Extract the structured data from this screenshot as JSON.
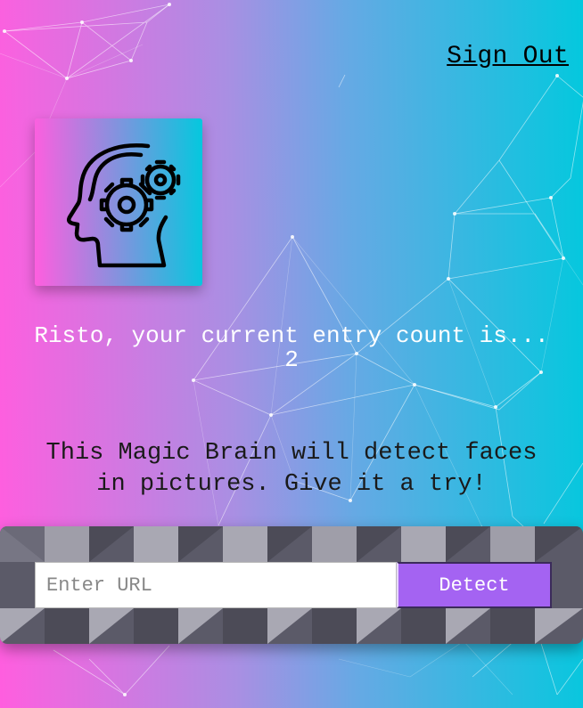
{
  "nav": {
    "sign_out_label": "Sign Out"
  },
  "logo": {
    "icon": "brain-gears-icon"
  },
  "rank": {
    "message": "Risto, your current entry count is...",
    "count": "2"
  },
  "description": {
    "line1": "This Magic Brain will detect faces",
    "line2": "in pictures. Give it a try!"
  },
  "form": {
    "input_placeholder": "Enter URL",
    "input_value": "",
    "button_label": "Detect"
  },
  "colors": {
    "gradient_start": "#ff5edf",
    "gradient_end": "#04c8de",
    "button": "#a463f2"
  }
}
